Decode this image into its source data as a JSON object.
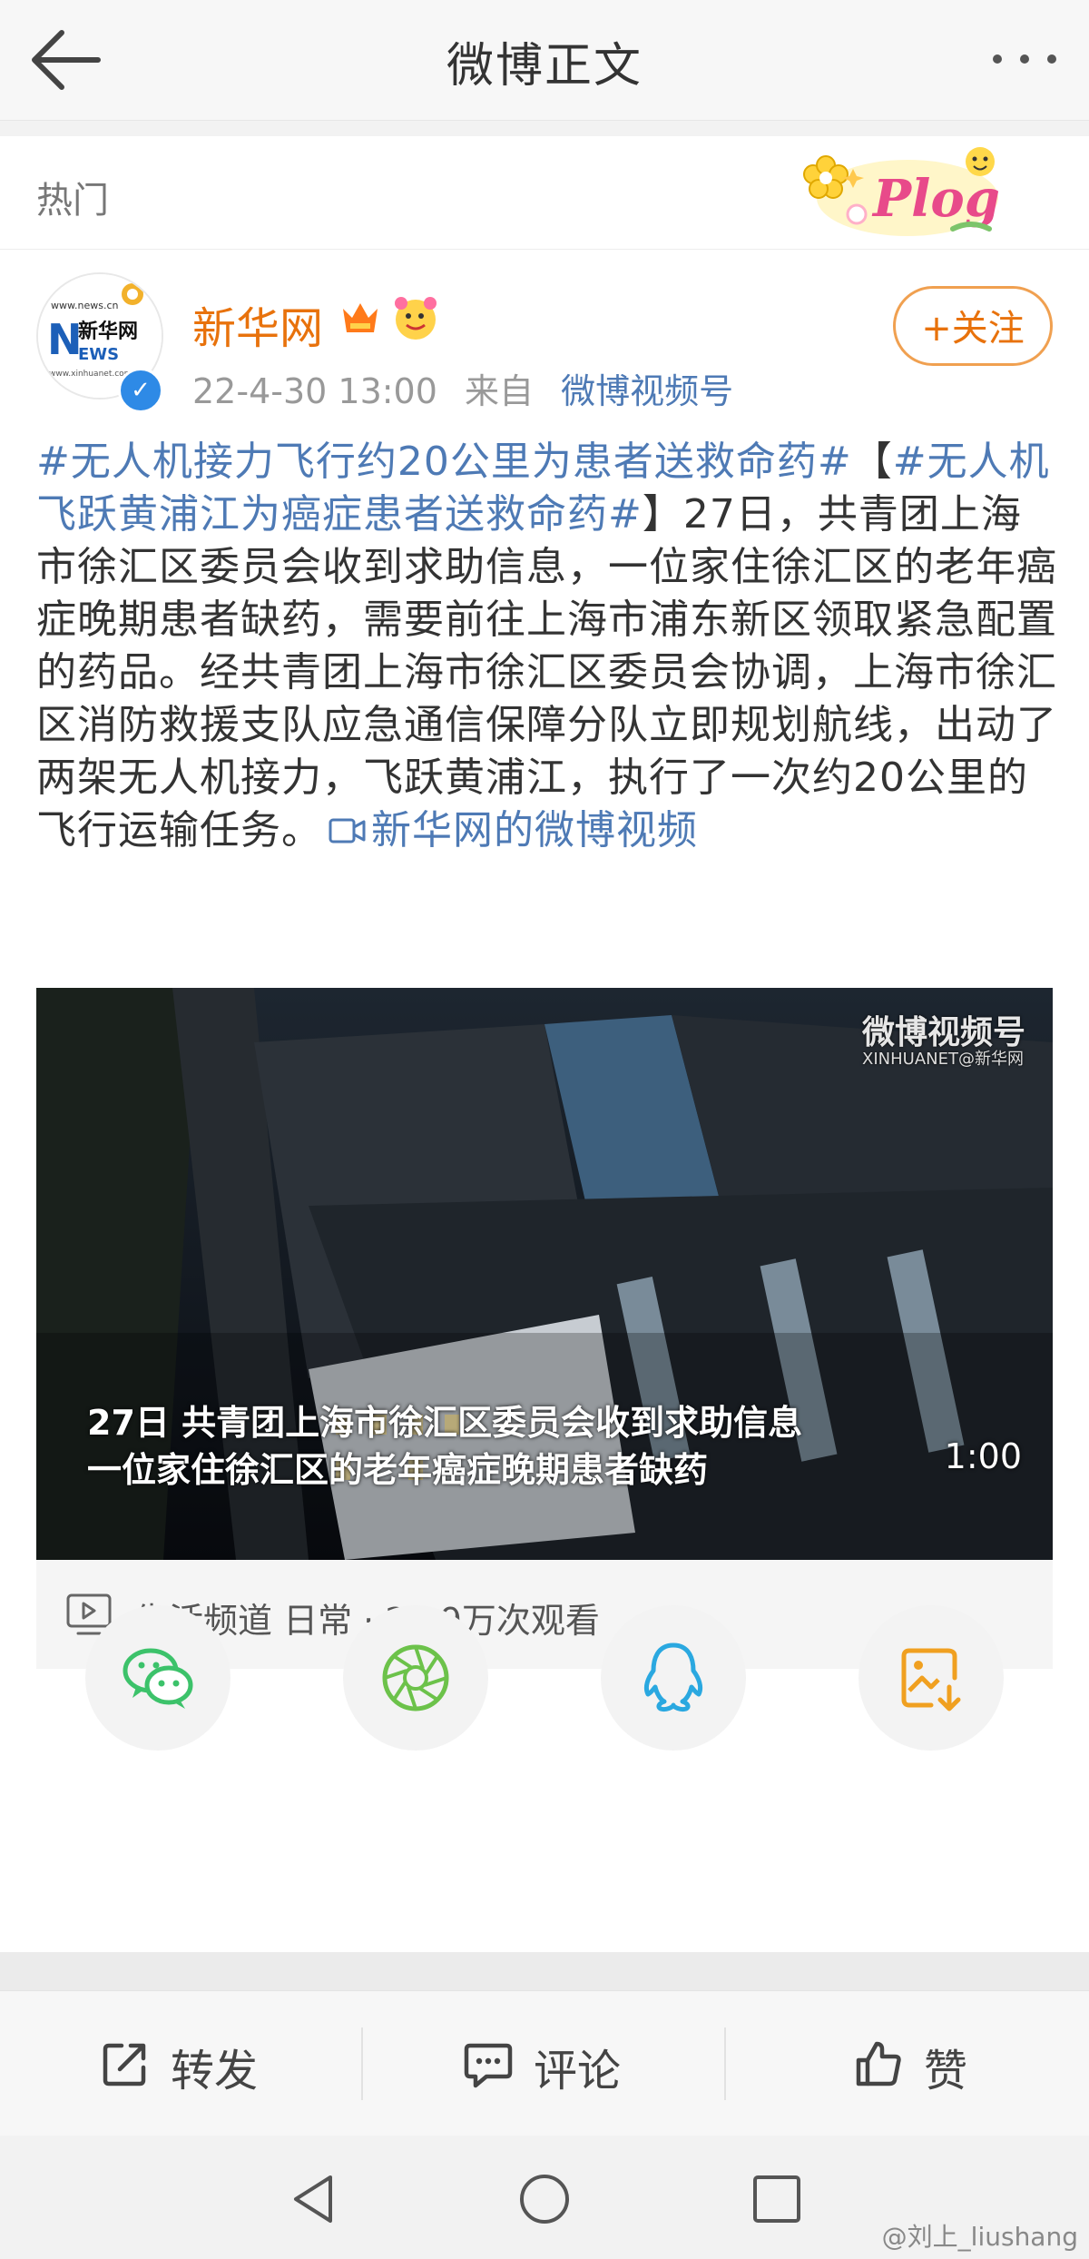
{
  "header": {
    "title": "微博正文"
  },
  "section": {
    "label": "热门"
  },
  "post": {
    "username": "新华网",
    "timestamp": "22-4-30 13:00",
    "source_prefix": "来自",
    "source": "微博视频号",
    "follow_label": "+关注",
    "text_parts": {
      "tag1": "#无人机接力飞行约20公里为患者送救命药#",
      "bracket_open": "【",
      "tag2": "#无人机飞跃黄浦江为癌症患者送救命药#",
      "body": "】27日，共青团上海市徐汇区委员会收到求助信息，一位家住徐汇区的老年癌症晚期患者缺药，需要前往上海市浦东新区领取紧急配置的药品。经共青团上海市徐汇区委员会协调，上海市徐汇区消防救援支队应急通信保障分队立即规划航线，出动了两架无人机接力，飞跃黄浦江，执行了一次约20公里的飞行运输任务。",
      "video_link": "新华网的微博视频"
    }
  },
  "video": {
    "caption_line1": "27日 共青团上海市徐汇区委员会收到求助信息",
    "caption_line2": "一位家住徐汇区的老年癌症晚期患者缺药",
    "duration": "1:00",
    "watermark": "微博视频号",
    "watermark_sub": "XINHUANET@新华网",
    "info": "生活频道 日常 · 28.9万次观看"
  },
  "share_targets": [
    "wechat-icon",
    "moments-icon",
    "qq-icon",
    "save-image-icon"
  ],
  "actions": {
    "repost": "转发",
    "comment": "评论",
    "like": "赞"
  },
  "footer_watermark": "@刘上_liushang",
  "colors": {
    "accent_orange": "#e8720c",
    "link_blue": "#4e7ab5",
    "wechat_green": "#3cc26a",
    "qq_blue": "#2aa8e0",
    "save_orange": "#f0a020"
  }
}
